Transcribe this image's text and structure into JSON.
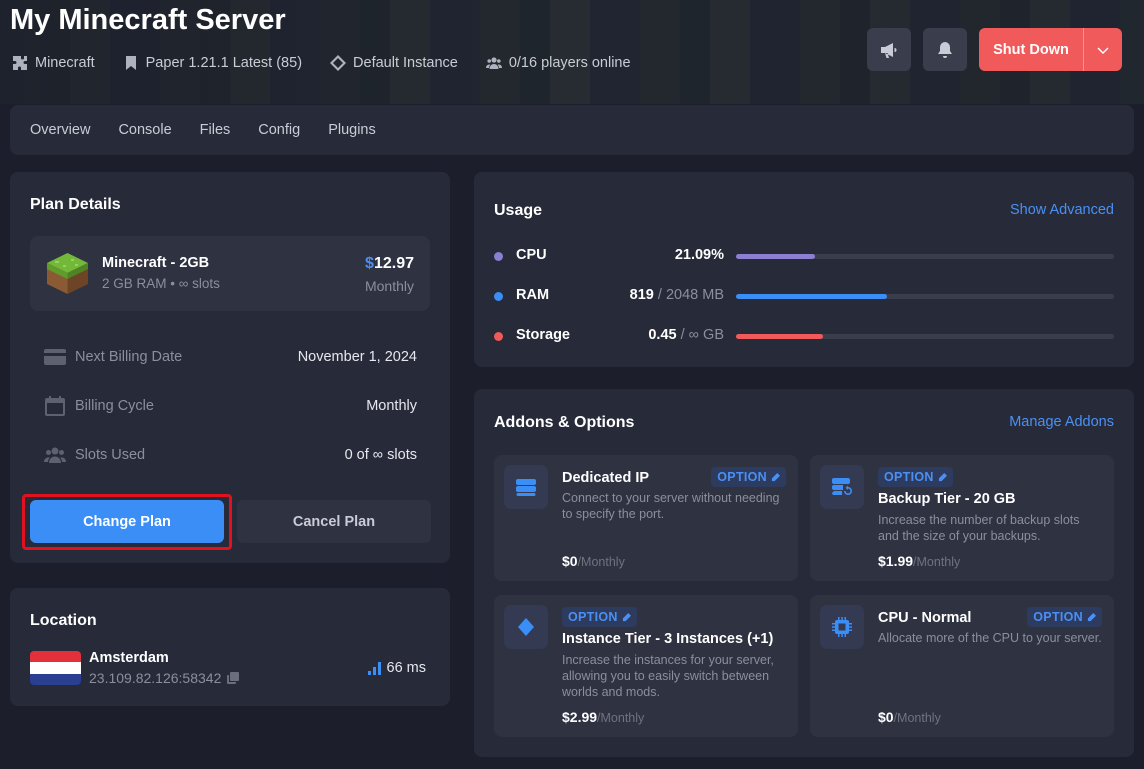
{
  "header": {
    "title": "My Minecraft Server",
    "meta": [
      {
        "icon": "puzzle-icon",
        "text": "Minecraft"
      },
      {
        "icon": "bookmark-icon",
        "text": "Paper 1.21.1 Latest (85)"
      },
      {
        "icon": "diamond-icon",
        "text": "Default Instance"
      },
      {
        "icon": "players-icon",
        "text": "0/16 players online"
      }
    ],
    "shutdown_label": "Shut Down"
  },
  "tabs": [
    "Overview",
    "Console",
    "Files",
    "Config",
    "Plugins"
  ],
  "plan": {
    "heading": "Plan Details",
    "name": "Minecraft - 2GB",
    "subtitle": "2 GB RAM  •  ∞ slots",
    "price_symbol": "$",
    "price": "12.97",
    "cycle": "Monthly",
    "rows": [
      {
        "label": "Next Billing Date",
        "value": "November 1, 2024"
      },
      {
        "label": "Billing Cycle",
        "value": "Monthly"
      },
      {
        "label": "Slots Used",
        "value": "0 of ∞ slots"
      }
    ],
    "change_label": "Change Plan",
    "cancel_label": "Cancel Plan"
  },
  "location": {
    "heading": "Location",
    "city": "Amsterdam",
    "ip": "23.109.82.126:58342",
    "ping": "66 ms"
  },
  "usage": {
    "heading": "Usage",
    "advanced_link": "Show Advanced",
    "rows": [
      {
        "name": "CPU",
        "value": "21.09%",
        "total": "",
        "fraction": 0.21,
        "color": "#8a7fd1"
      },
      {
        "name": "RAM",
        "value": "819",
        "total": " / 2048 MB",
        "fraction": 0.4,
        "color": "#3a8ef6"
      },
      {
        "name": "Storage",
        "value": "0.45",
        "total": " / ∞ GB",
        "fraction": 0.23,
        "color": "#f15a5a"
      }
    ]
  },
  "addons": {
    "heading": "Addons & Options",
    "manage_link": "Manage Addons",
    "badge": "OPTION",
    "items": [
      {
        "title": "Dedicated IP",
        "desc": "Connect to your server without needing to specify the port.",
        "price": "$0",
        "period": "/Monthly"
      },
      {
        "title": "Backup Tier - 20 GB",
        "desc": "Increase the number of backup slots and the size of your backups.",
        "price": "$1.99",
        "period": "/Monthly"
      },
      {
        "title": "Instance Tier - 3 Instances (+1)",
        "desc": "Increase the instances for your server, allowing you to easily switch between worlds and mods.",
        "price": "$2.99",
        "period": "/Monthly"
      },
      {
        "title": "CPU - Normal",
        "desc": "Allocate more of the CPU to your server.",
        "price": "$0",
        "period": "/Monthly"
      }
    ]
  }
}
